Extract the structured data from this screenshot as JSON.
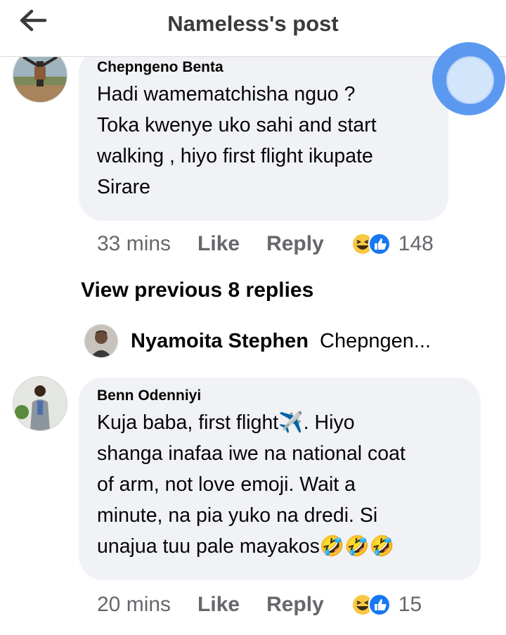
{
  "header": {
    "title": "Nameless's post",
    "back_icon": "arrow-left-icon"
  },
  "comments": [
    {
      "author": "Chepngeno Benta",
      "lines": [
        "Hadi wamematchisha nguo ?",
        "Toka kwenye uko sahi and start",
        "walking , hiyo first flight ikupate",
        "Sirare"
      ],
      "time": "33 mins",
      "like": "Like",
      "reply": "Reply",
      "reactions": [
        "haha-icon",
        "thumbs-up-icon"
      ],
      "count": "148"
    },
    {
      "author": "Benn Odenniyi",
      "lines": [
        "Kuja baba, first flight✈️. Hiyo",
        "shanga inafaa iwe na national coat",
        "of arm, not love emoji. Wait a",
        "minute, na pia yuko na dredi. Si",
        "unajua tuu pale mayakos🤣🤣🤣"
      ],
      "time": "20 mins",
      "like": "Like",
      "reply": "Reply",
      "reactions": [
        "haha-icon",
        "thumbs-up-icon"
      ],
      "count": "15"
    }
  ],
  "view_previous": "View previous 8 replies",
  "reply_preview": {
    "name": "Nyamoita Stephen",
    "text": "Chepngen..."
  },
  "colors": {
    "accent": "#1877f2",
    "floating": "#5a99ef",
    "bubble": "#f0f2f5",
    "meta": "#65676b"
  }
}
